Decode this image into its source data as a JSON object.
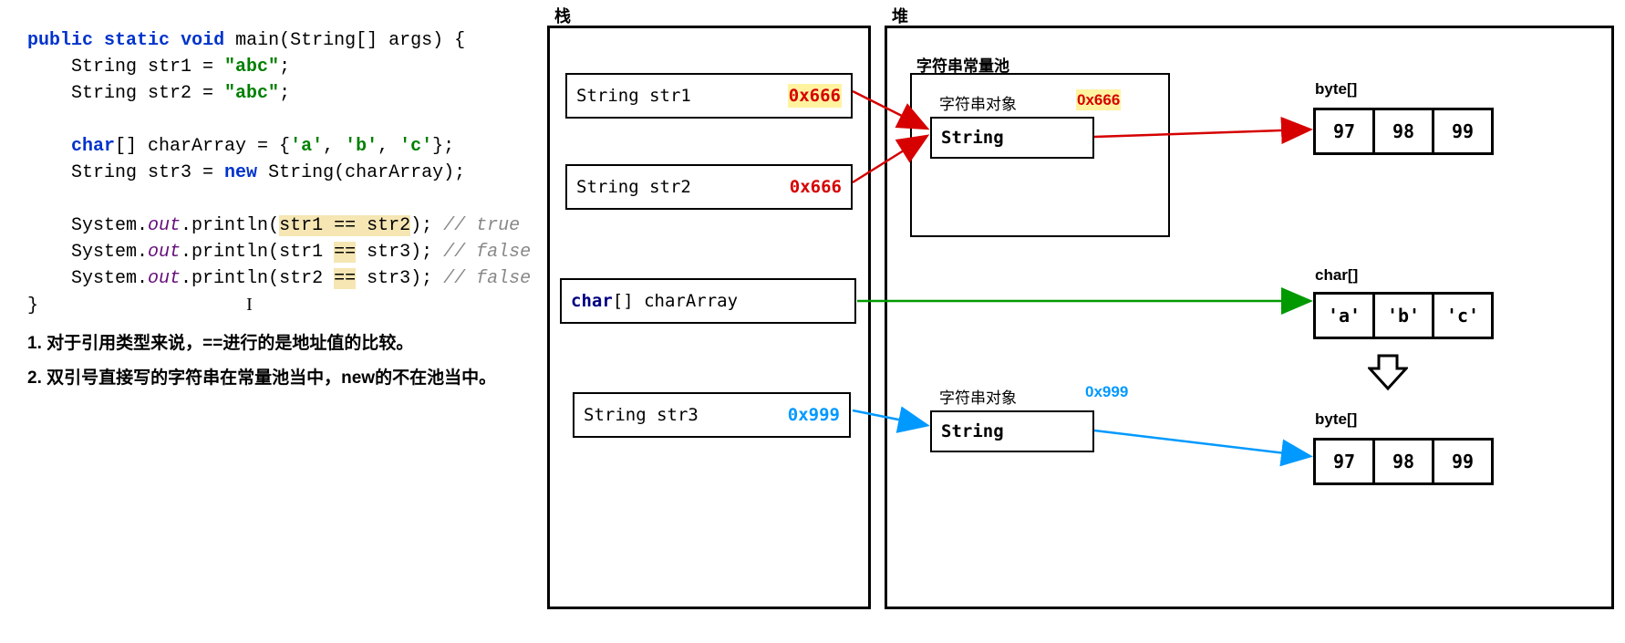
{
  "code": {
    "sig_public": "public",
    "sig_static": "static",
    "sig_void": "void",
    "sig_main": " main(String[] args) {",
    "l2a": "    String str1 = ",
    "l2b": "\"abc\"",
    "l2c": ";",
    "l3a": "    String str2 = ",
    "l3b": "\"abc\"",
    "l3c": ";",
    "blank": "",
    "l5a": "    ",
    "l5b": "char",
    "l5c": "[] charArray = {",
    "l5d": "'a'",
    "l5e": ", ",
    "l5f": "'b'",
    "l5g": ", ",
    "l5h": "'c'",
    "l5i": "};",
    "l6a": "    String str3 = ",
    "l6b": "new",
    "l6c": " String(charArray);",
    "l8a": "    System.",
    "l8out": "out",
    "l8b": ".println(",
    "l8c": "str1 == str2",
    "l8d": "); ",
    "l8cmt": "// true",
    "l9a": "    System.",
    "l9b": ".println(str1 ",
    "l9eq": "==",
    "l9c": " str3); ",
    "l9cmt": "// false",
    "l10a": "    System.",
    "l10b": ".println(str2 ",
    "l10eq": "==",
    "l10c": " str3); ",
    "l10cmt": "// false",
    "close": "}"
  },
  "notes": {
    "n1": "1. 对于引用类型来说，==进行的是地址值的比较。",
    "n2": "2. 双引号直接写的字符串在常量池当中，new的不在池当中。"
  },
  "labels": {
    "stack": "栈",
    "heap": "堆",
    "pool": "字符串常量池",
    "str_obj1": "字符串对象",
    "str_obj2": "字符串对象",
    "byte_arr": "byte[]",
    "char_arr": "char[]"
  },
  "stack": {
    "str1_name": "String str1",
    "str1_addr": "0x666",
    "str2_name": "String str2",
    "str2_addr": "0x666",
    "charArr_char": "char",
    "charArr_rest": "[] charArray",
    "str3_name": "String str3",
    "str3_addr": "0x999"
  },
  "heap": {
    "string_class": "String",
    "addr_666": "0x666",
    "addr_999": "0x999",
    "bytes": [
      "97",
      "98",
      "99"
    ],
    "chars": [
      "'a'",
      "'b'",
      "'c'"
    ]
  }
}
